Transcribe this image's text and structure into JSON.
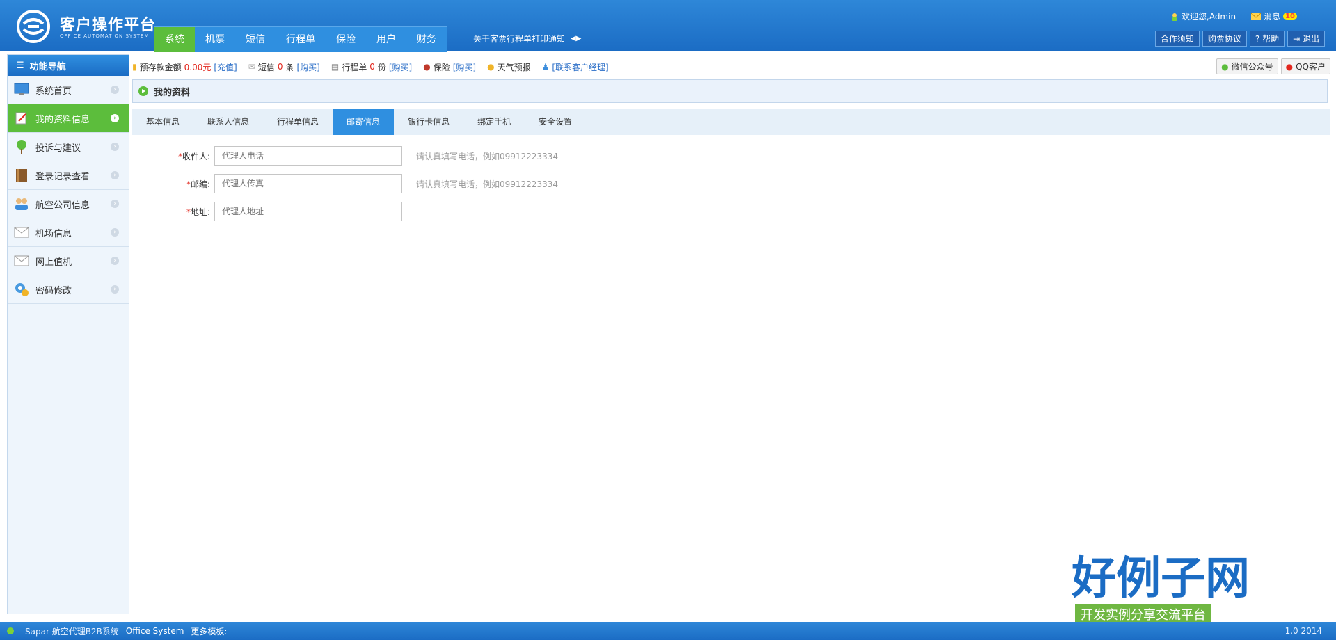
{
  "brand": {
    "title": "客户操作平台",
    "subtitle": "OFFICE AUTOMATION SYSTEM"
  },
  "main_nav": [
    {
      "label": "系统",
      "active": true
    },
    {
      "label": "机票"
    },
    {
      "label": "短信"
    },
    {
      "label": "行程单"
    },
    {
      "label": "保险"
    },
    {
      "label": "用户"
    },
    {
      "label": "财务"
    }
  ],
  "notice": {
    "text": "关于客票行程单打印通知",
    "arrows": "◀▶"
  },
  "top_right": {
    "welcome": "欢迎您,Admin",
    "messages_label": "消息",
    "messages_count": "10"
  },
  "top_buttons": [
    "合作须知",
    "购票协议",
    "帮助",
    "退出"
  ],
  "sidebar": {
    "title": "功能导航",
    "items": [
      {
        "label": "系统首页",
        "icon": "monitor-icon"
      },
      {
        "label": "我的资料信息",
        "icon": "edit-icon",
        "active": true
      },
      {
        "label": "投诉与建议",
        "icon": "tree-icon"
      },
      {
        "label": "登录记录查看",
        "icon": "book-icon"
      },
      {
        "label": "航空公司信息",
        "icon": "users-icon"
      },
      {
        "label": "机场信息",
        "icon": "mail-icon"
      },
      {
        "label": "网上值机",
        "icon": "mail-icon"
      },
      {
        "label": "密码修改",
        "icon": "gear-icon"
      }
    ]
  },
  "infobar": {
    "deposit_label": "预存款金额",
    "deposit_amount": "0.00元",
    "recharge": "[充值]",
    "sms_label": "短信",
    "sms_count": "0",
    "sms_unit": "条",
    "sms_buy": "[购买]",
    "itinerary_label": "行程单",
    "itinerary_count": "0",
    "itinerary_unit": "份",
    "itinerary_buy": "[购买]",
    "insurance_label": "保险",
    "insurance_buy": "[购买]",
    "weather": "天气预报",
    "contact": "[联系客户经理]",
    "wechat": "微信公众号",
    "qq": "QQ客户"
  },
  "section": {
    "title": "我的资料"
  },
  "tabs": [
    {
      "label": "基本信息"
    },
    {
      "label": "联系人信息"
    },
    {
      "label": "行程单信息"
    },
    {
      "label": "邮寄信息",
      "active": true
    },
    {
      "label": "银行卡信息"
    },
    {
      "label": "绑定手机"
    },
    {
      "label": "安全设置"
    }
  ],
  "form": {
    "rows": [
      {
        "label": "收件人:",
        "placeholder": "代理人电话",
        "hint": "请认真填写电话，例如09912223334"
      },
      {
        "label": "邮编:",
        "placeholder": "代理人传真",
        "hint": "请认真填写电话，例如09912223334"
      },
      {
        "label": "地址:",
        "placeholder": "代理人地址",
        "hint": ""
      }
    ]
  },
  "footer": {
    "system": "Sapar 航空代理B2B系统",
    "office": "Office System",
    "more": "更多模板:",
    "version": "1.0 2014"
  },
  "watermark": {
    "title": "好例子网",
    "subtitle": "开发实例分享交流平台"
  },
  "colors": {
    "header_blue": "#1b6cc4",
    "active_green": "#5cbd3c",
    "tab_blue": "#2f8fe0",
    "accent_red": "#e2261d"
  }
}
